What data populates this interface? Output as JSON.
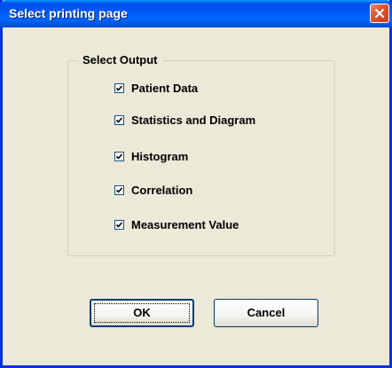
{
  "window": {
    "title": "Select printing page"
  },
  "group": {
    "title": "Select Output"
  },
  "options": [
    {
      "label": "Patient Data",
      "checked": true
    },
    {
      "label": "Statistics and Diagram",
      "checked": true
    },
    {
      "label": "Histogram",
      "checked": true
    },
    {
      "label": "Correlation",
      "checked": true
    },
    {
      "label": "Measurement Value",
      "checked": true
    }
  ],
  "buttons": {
    "ok_label": "OK",
    "cancel_label": "Cancel"
  },
  "icons": {
    "close": "close-icon",
    "check": "checkmark-icon"
  },
  "colors": {
    "titlebar": "#0055e5",
    "close_button": "#d9532d",
    "dialog_bg": "#ece9d8",
    "window_border": "#0831d9"
  }
}
